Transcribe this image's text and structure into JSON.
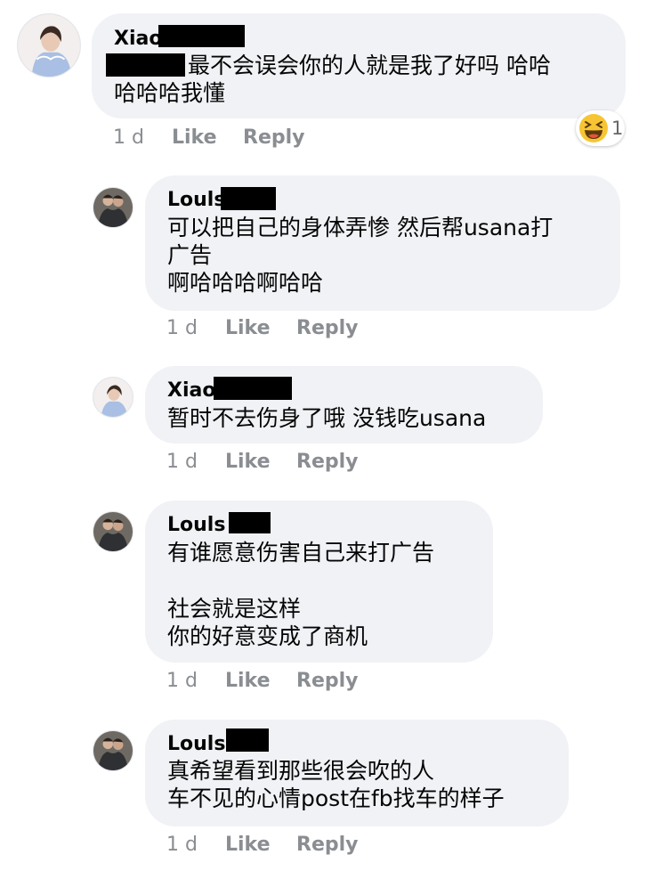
{
  "comments": [
    {
      "author": "Xiao",
      "lines": [
        "最不会误会你的人就是我了好吗 哈哈",
        "哈哈哈我懂"
      ],
      "time": "1 d",
      "like": "Like",
      "reply": "Reply",
      "reaction": {
        "icon": "laughing-emoji-icon",
        "count": "1"
      }
    },
    {
      "author": "Louls",
      "lines": [
        "可以把自己的身体弄惨 然后帮usana打",
        "广告",
        "啊哈哈哈啊哈哈"
      ],
      "time": "1 d",
      "like": "Like",
      "reply": "Reply"
    },
    {
      "author": "Xiao",
      "lines": [
        "暂时不去伤身了哦 没钱吃usana"
      ],
      "time": "1 d",
      "like": "Like",
      "reply": "Reply"
    },
    {
      "author": "Louls",
      "lines": [
        "有谁愿意伤害自己来打广告",
        "",
        "社会就是这样",
        "你的好意变成了商机"
      ],
      "time": "1 d",
      "like": "Like",
      "reply": "Reply"
    },
    {
      "author": "Louls",
      "lines": [
        "真希望看到那些很会吹的人",
        "车不见的心情post在fb找车的样子"
      ],
      "time": "1 d",
      "like": "Like",
      "reply": "Reply"
    }
  ],
  "colors": {
    "bubble": "#f0f2f5",
    "meta_text": "#8a8d91",
    "body_text": "#050505",
    "redaction": "#000000"
  }
}
